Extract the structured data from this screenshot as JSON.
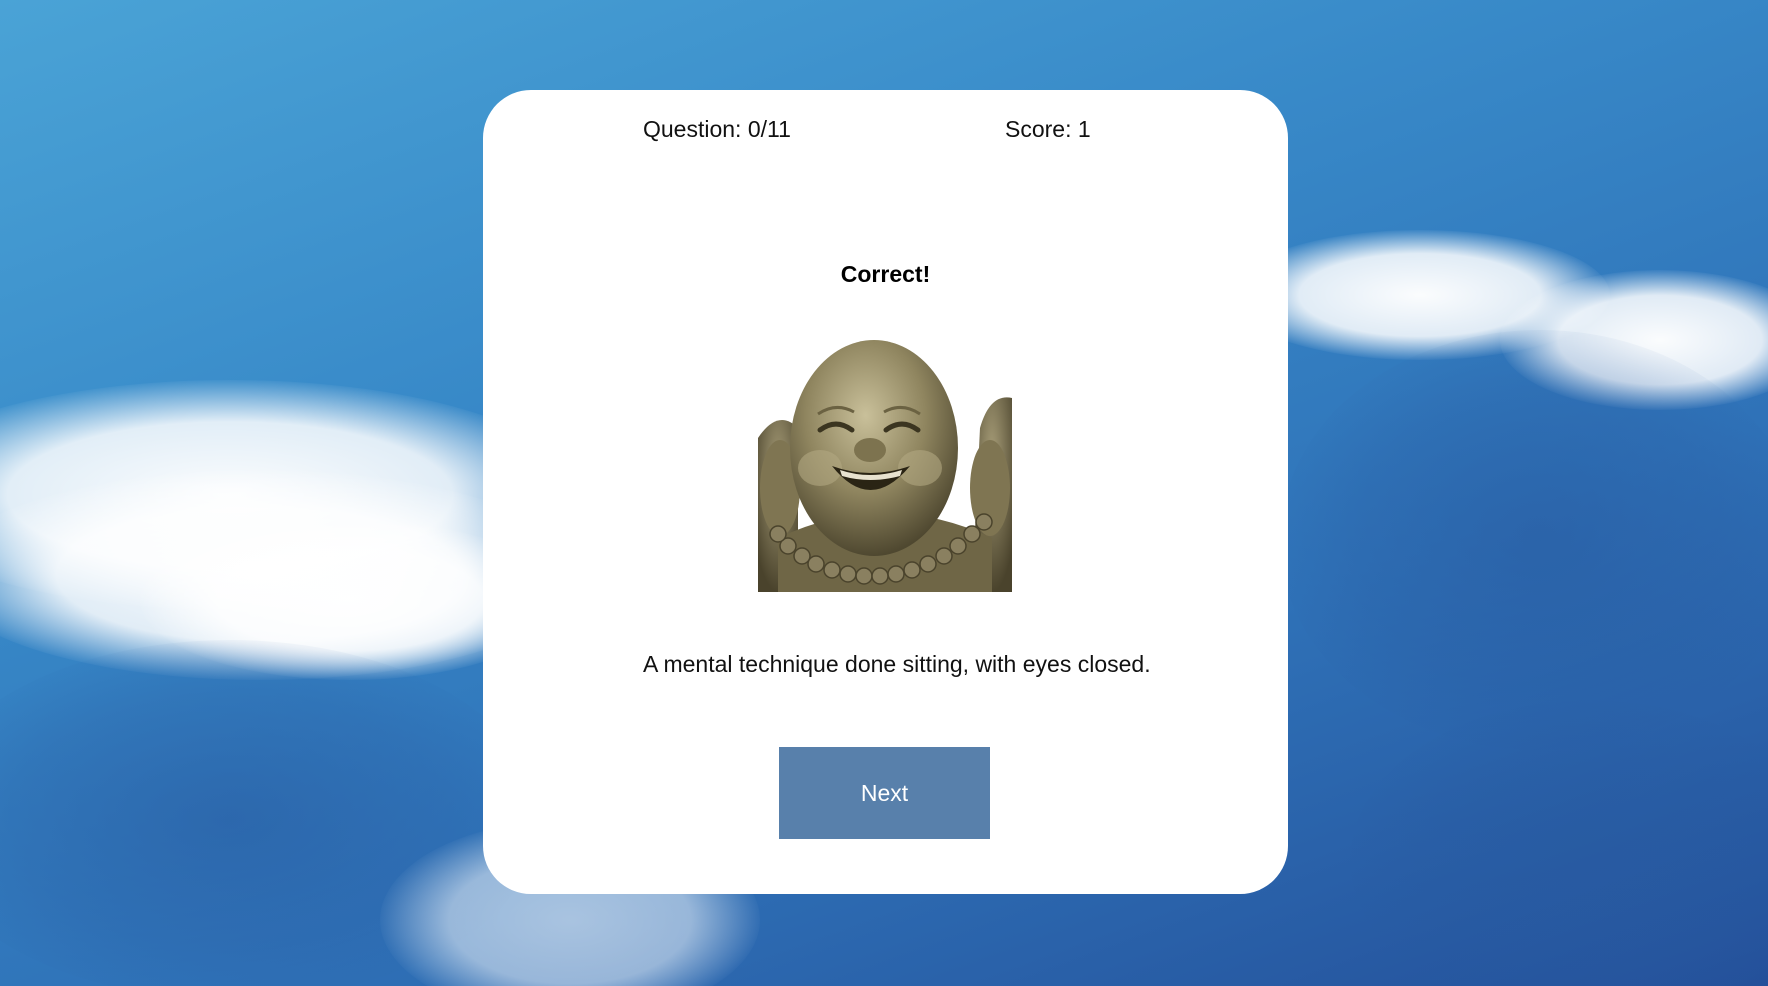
{
  "quiz": {
    "question_counter": "Question: 0/11",
    "score": "Score: 1",
    "feedback": "Correct!",
    "description": "A mental technique done sitting, with eyes closed.",
    "next_label": "Next",
    "image_subject": "laughing-buddha-statue"
  },
  "colors": {
    "button_bg": "#5880ab",
    "card_bg": "#ffffff",
    "sky": "#3889c8"
  }
}
